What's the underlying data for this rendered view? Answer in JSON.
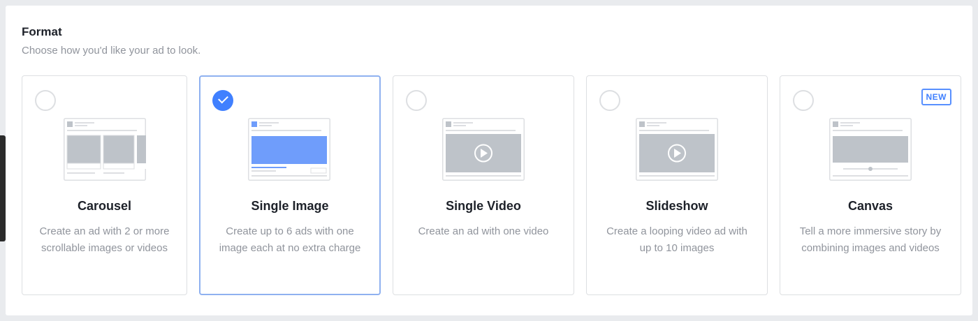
{
  "format": {
    "title": "Format",
    "subtitle": "Choose how you'd like your ad to look."
  },
  "cards": [
    {
      "title": "Carousel",
      "description": "Create an ad with 2 or more scrollable images or videos",
      "selected": false,
      "preview_icon": "carousel-preview-icon"
    },
    {
      "title": "Single Image",
      "description": "Create up to 6 ads with one image each at no extra charge",
      "selected": true,
      "preview_icon": "single-image-preview-icon"
    },
    {
      "title": "Single Video",
      "description": "Create an ad with one video",
      "selected": false,
      "preview_icon": "single-video-preview-icon"
    },
    {
      "title": "Slideshow",
      "description": "Create a looping video ad with up to 10 images",
      "selected": false,
      "preview_icon": "slideshow-preview-icon"
    },
    {
      "title": "Canvas",
      "description": "Tell a more immersive story by combining images and videos",
      "selected": false,
      "badge": "NEW",
      "preview_icon": "canvas-preview-icon"
    }
  ],
  "colors": {
    "accent": "#4080ff",
    "selected_border": "#8fb1f0",
    "muted_text": "#90949c",
    "title_text": "#1d2129",
    "card_border": "#dddfe2",
    "placeholder": "#bec3c9",
    "image_blue": "#6f9dfb"
  }
}
